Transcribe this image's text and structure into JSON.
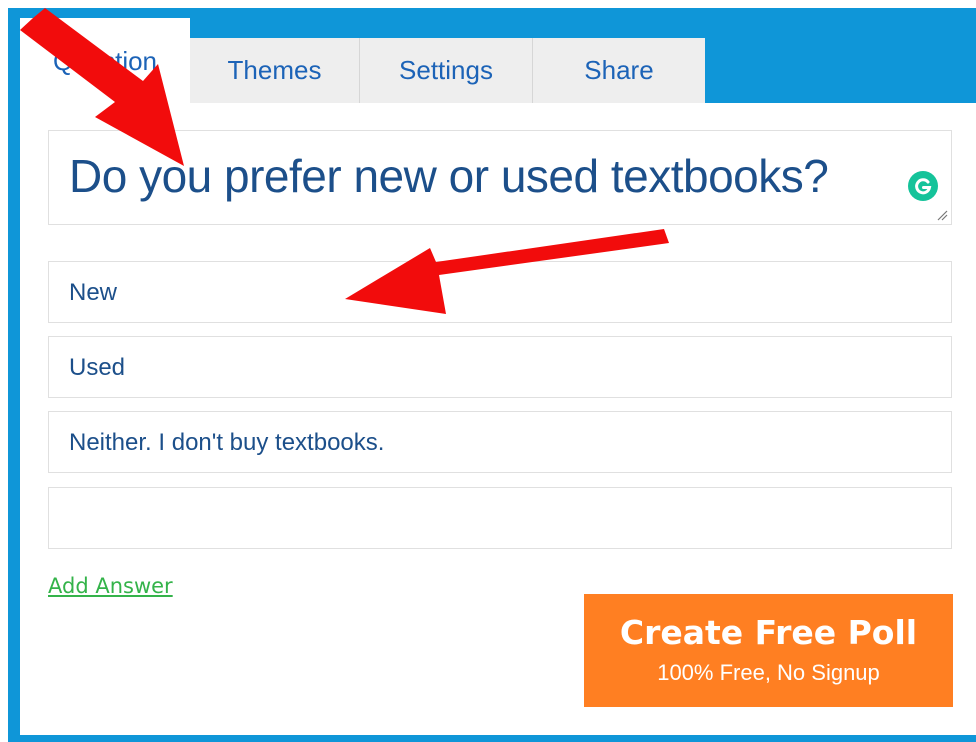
{
  "tabs": [
    {
      "label": "Question",
      "active": true
    },
    {
      "label": "Themes",
      "active": false
    },
    {
      "label": "Settings",
      "active": false
    },
    {
      "label": "Share",
      "active": false
    }
  ],
  "question": {
    "value": "Do you prefer new or used textbooks?"
  },
  "answers": [
    {
      "value": "New"
    },
    {
      "value": "Used"
    },
    {
      "value": "Neither. I don't buy textbooks."
    },
    {
      "value": ""
    }
  ],
  "add_answer_label": "Add Answer",
  "create_button": {
    "title": "Create Free Poll",
    "subtitle": "100% Free, No Signup"
  },
  "colors": {
    "frame_blue": "#0f96d8",
    "tab_text": "#1c63b7",
    "question_text": "#1c4f8a",
    "cta_orange": "#ff7f22",
    "link_green": "#34b34a",
    "arrow_red": "#f20c0c"
  },
  "icons": [
    "grammarly-icon",
    "resize-handle-icon",
    "red-arrow-annotation"
  ]
}
